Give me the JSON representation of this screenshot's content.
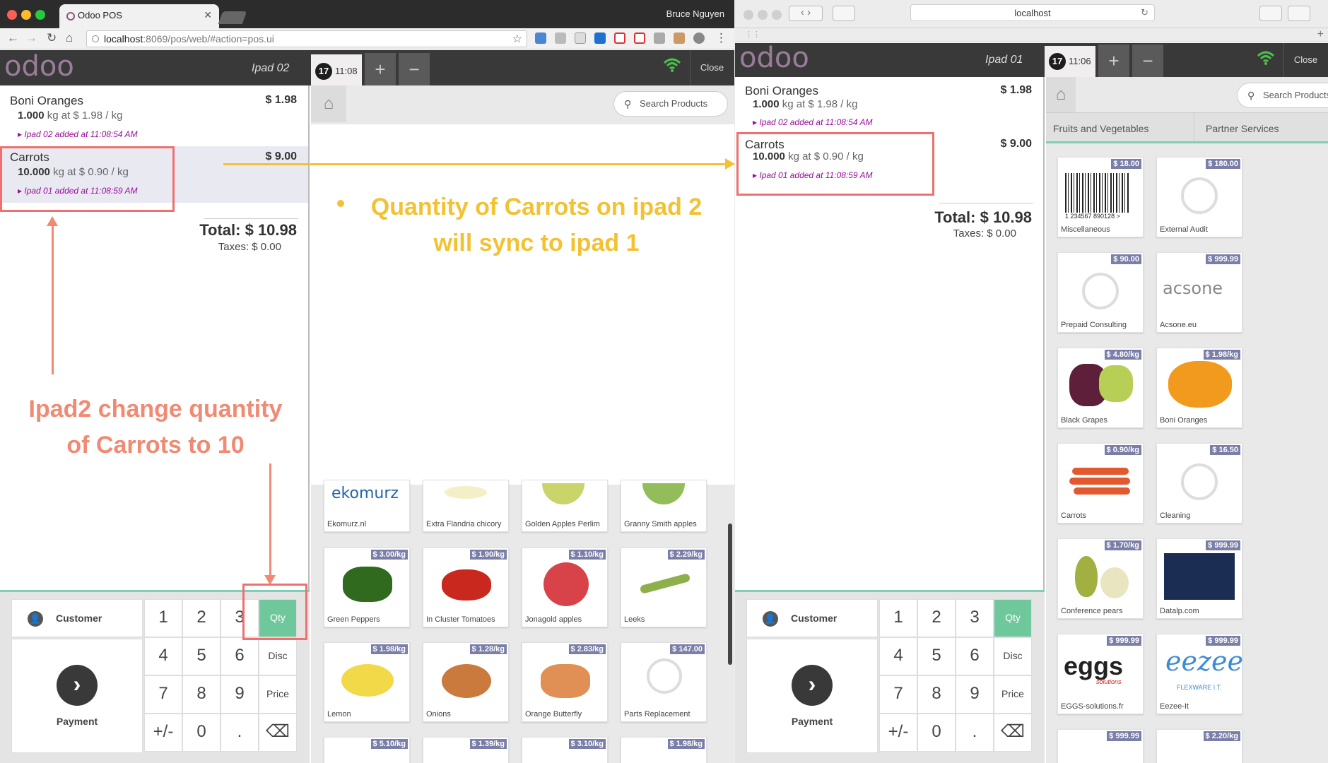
{
  "left_browser": {
    "tab_title": "Odoo POS",
    "user": "Bruce Nguyen",
    "url_host": "localhost",
    "url_rest": ":8069/pos/web/#action=pos.ui"
  },
  "right_browser": {
    "address": "localhost"
  },
  "pos_left": {
    "logo": "odoo",
    "shop": "Ipad 02",
    "order_number": "17",
    "order_time": "11:08",
    "plus": "+",
    "minus": "−",
    "close": "Close",
    "lines": [
      {
        "name": "Boni Oranges",
        "price": "$ 1.98",
        "qty": "1.000",
        "unit": "kg at $ 1.98 / kg",
        "note": "Ipad 02 added at 11:08:54 AM"
      },
      {
        "name": "Carrots",
        "price": "$ 9.00",
        "qty": "10.000",
        "unit": "kg at $ 0.90 / kg",
        "note": "Ipad 01 added at 11:08:59 AM"
      }
    ],
    "total": "Total: $ 10.98",
    "taxes": "Taxes: $ 0.00",
    "search": "Search Products",
    "customer": "Customer",
    "payment": "Payment",
    "numpad": [
      "1",
      "2",
      "3",
      "Qty",
      "4",
      "5",
      "6",
      "Disc",
      "7",
      "8",
      "9",
      "Price",
      "+/-",
      "0",
      ".",
      "⌫"
    ],
    "products": [
      {
        "name": "Ekomurz.nl",
        "price": ""
      },
      {
        "name": "Extra Flandria chicory",
        "price": ""
      },
      {
        "name": "Golden Apples Perlim",
        "price": ""
      },
      {
        "name": "Granny Smith apples",
        "price": ""
      },
      {
        "name": "Green Peppers",
        "price": "$ 3.00/kg"
      },
      {
        "name": "In Cluster Tomatoes",
        "price": "$ 1.90/kg"
      },
      {
        "name": "Jonagold apples",
        "price": "$ 1.10/kg"
      },
      {
        "name": "Leeks",
        "price": "$ 2.29/kg"
      },
      {
        "name": "Lemon",
        "price": "$ 1.98/kg"
      },
      {
        "name": "Onions",
        "price": "$ 1.28/kg"
      },
      {
        "name": "Orange Butterfly",
        "price": "$ 2.83/kg"
      },
      {
        "name": "Parts Replacement",
        "price": "$ 147.00"
      },
      {
        "name": "",
        "price": "$ 5.10/kg"
      },
      {
        "name": "",
        "price": "$ 1.39/kg"
      },
      {
        "name": "",
        "price": "$ 3.10/kg"
      },
      {
        "name": "",
        "price": "$ 1.98/kg"
      }
    ]
  },
  "pos_right": {
    "logo": "odoo",
    "shop": "Ipad 01",
    "order_number": "17",
    "order_time": "11:06",
    "plus": "+",
    "minus": "−",
    "close": "Close",
    "lines": [
      {
        "name": "Boni Oranges",
        "price": "$ 1.98",
        "qty": "1.000",
        "unit": "kg at $ 1.98 / kg",
        "note": "Ipad 02 added at 11:08:54 AM"
      },
      {
        "name": "Carrots",
        "price": "$ 9.00",
        "qty": "10.000",
        "unit": "kg at $ 0.90 / kg",
        "note": "Ipad 01 added at 11:08:59 AM"
      }
    ],
    "total": "Total: $ 10.98",
    "taxes": "Taxes: $ 0.00",
    "search": "Search Products",
    "categories": [
      "Fruits and Vegetables",
      "Partner Services"
    ],
    "customer": "Customer",
    "payment": "Payment",
    "numpad": [
      "1",
      "2",
      "3",
      "Qty",
      "4",
      "5",
      "6",
      "Disc",
      "7",
      "8",
      "9",
      "Price",
      "+/-",
      "0",
      ".",
      "⌫"
    ],
    "products": [
      {
        "name": "Miscellaneous",
        "price": "$ 18.00"
      },
      {
        "name": "External Audit",
        "price": "$ 180.00"
      },
      {
        "name": "Prepaid Consulting",
        "price": "$ 90.00"
      },
      {
        "name": "Acsone.eu",
        "price": "$ 999.99"
      },
      {
        "name": "Black Grapes",
        "price": "$ 4.80/kg"
      },
      {
        "name": "Boni Oranges",
        "price": "$ 1.98/kg"
      },
      {
        "name": "Carrots",
        "price": "$ 0.90/kg"
      },
      {
        "name": "Cleaning",
        "price": "$ 16.50"
      },
      {
        "name": "Conference pears",
        "price": "$ 1.70/kg"
      },
      {
        "name": "Datalp.com",
        "price": "$ 999.99"
      },
      {
        "name": "EGGS-solutions.fr",
        "price": "$ 999.99"
      },
      {
        "name": "Eezee-It",
        "price": "$ 999.99"
      },
      {
        "name": "",
        "price": "$ 999.99"
      },
      {
        "name": "",
        "price": "$ 2.20/kg"
      }
    ]
  },
  "annotations": {
    "sync_line1": "Quantity of Carrots on ipad 2",
    "sync_line2": "will sync to ipad 1",
    "change_line1": "Ipad2 change quantity",
    "change_line2": "of Carrots to 10"
  },
  "logos": {
    "ekomurz": "ekomurz",
    "acsone": "acsone",
    "eggs": "eggs",
    "eggs_sub": "solutions",
    "eezee": "eezee",
    "eezee_sub": "FLEXWARE I.T.",
    "barcode_digits": "1 234567 890128 >"
  },
  "colors": {
    "annotation_orange": "#f08a73",
    "annotation_yellow": "#f2c233",
    "qty_green": "#6ec89b",
    "note_purple": "#9a0d9a"
  }
}
